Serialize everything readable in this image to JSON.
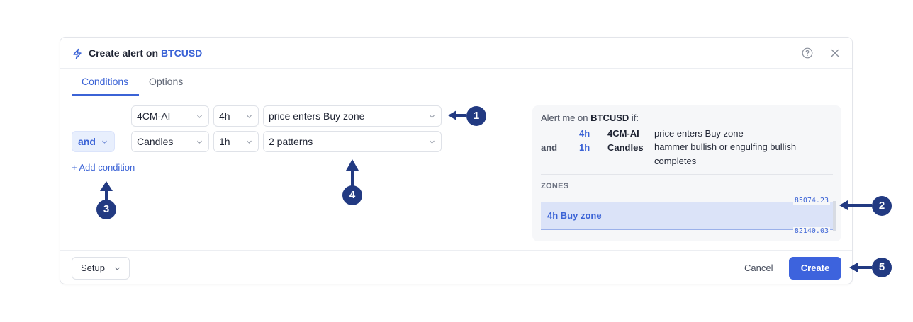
{
  "dialog": {
    "title_prefix": "Create alert on",
    "symbol": "BTCUSD",
    "tabs": [
      {
        "label": "Conditions"
      },
      {
        "label": "Options"
      }
    ]
  },
  "conditions": [
    {
      "indicator": "4CM-AI",
      "timeframe": "4h",
      "condition": "price enters Buy zone"
    },
    {
      "operator": "and",
      "indicator": "Candles",
      "timeframe": "1h",
      "condition": "2 patterns"
    }
  ],
  "add_condition_label": "+ Add condition",
  "summary": {
    "lead": "Alert me on",
    "symbol": "BTCUSD",
    "lead_suffix": "if:",
    "rows": [
      {
        "operator": "",
        "timeframe": "4h",
        "indicator": "4CM-AI",
        "condition": "price enters Buy zone"
      },
      {
        "operator": "and",
        "timeframe": "1h",
        "indicator": "Candles",
        "condition": "hammer bullish or engulfing bullish completes"
      }
    ],
    "zones_label": "ZONES",
    "zone": {
      "name": "4h Buy zone",
      "upper": "85074.23",
      "lower": "82140.03"
    }
  },
  "footer": {
    "setup_label": "Setup",
    "cancel_label": "Cancel",
    "create_label": "Create"
  },
  "markers": [
    "1",
    "2",
    "3",
    "4",
    "5"
  ],
  "colors": {
    "accent": "#3b63d6",
    "marker": "#223a82",
    "zone_fill": "#dbe3f8"
  }
}
